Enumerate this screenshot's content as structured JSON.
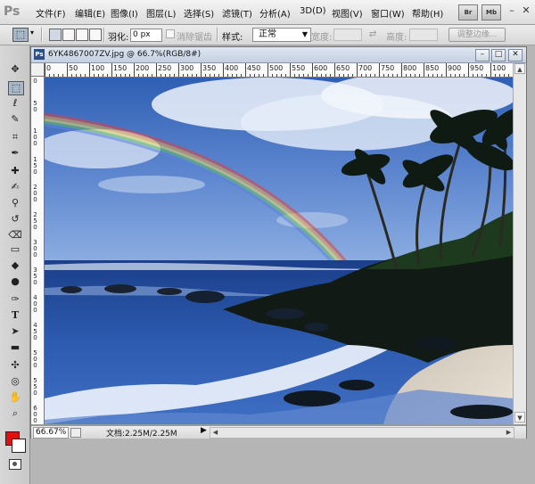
{
  "app": {
    "logo": "Ps"
  },
  "menu": {
    "items": [
      {
        "label": "文件(F)"
      },
      {
        "label": "编辑(E)"
      },
      {
        "label": "图像(I)"
      },
      {
        "label": "图层(L)"
      },
      {
        "label": "选择(S)"
      },
      {
        "label": "滤镜(T)"
      },
      {
        "label": "分析(A)"
      },
      {
        "label": "3D(D)"
      },
      {
        "label": "视图(V)"
      },
      {
        "label": "窗口(W)"
      },
      {
        "label": "帮助(H)"
      }
    ],
    "bridge_buttons": [
      {
        "label": "Br"
      },
      {
        "label": "Mb"
      }
    ],
    "window_controls": {
      "minimize": "–",
      "restore": "□",
      "close": "✕"
    }
  },
  "options": {
    "feather_label": "羽化:",
    "feather_value": "0 px",
    "antialias_label": "消除锯齿",
    "style_label": "样式:",
    "style_value": "正常",
    "width_label": "宽度:",
    "height_label": "高度:",
    "refine_edge_label": "调整边缘..."
  },
  "document": {
    "title": "6YK4867007ZV.jpg @ 66.7%(RGB/8#)",
    "zoom": "66.67%",
    "doc_info": "文档:2.25M/2.25M",
    "controls": {
      "minimize": "–",
      "restore": "□",
      "close": "✕"
    },
    "ruler_h": [
      "0",
      "50",
      "100",
      "150",
      "200",
      "250",
      "300",
      "350",
      "400",
      "450",
      "500",
      "550",
      "600",
      "650",
      "700",
      "750",
      "800",
      "850",
      "900",
      "950",
      "100"
    ],
    "ruler_v": [
      "0",
      "50",
      "100",
      "150",
      "200",
      "250",
      "300",
      "350",
      "400",
      "450",
      "500",
      "550",
      "600"
    ]
  },
  "tools": [
    {
      "name": "move-tool-icon",
      "glyph": "✥"
    },
    {
      "name": "marquee-tool-icon",
      "glyph": "⬚"
    },
    {
      "name": "lasso-tool-icon",
      "glyph": "ℓ"
    },
    {
      "name": "quick-selection-tool-icon",
      "glyph": "✎"
    },
    {
      "name": "crop-tool-icon",
      "glyph": "⌗"
    },
    {
      "name": "eyedropper-tool-icon",
      "glyph": "✒"
    },
    {
      "name": "healing-brush-tool-icon",
      "glyph": "✚"
    },
    {
      "name": "brush-tool-icon",
      "glyph": "✍"
    },
    {
      "name": "clone-stamp-tool-icon",
      "glyph": "⚲"
    },
    {
      "name": "history-brush-tool-icon",
      "glyph": "↺"
    },
    {
      "name": "eraser-tool-icon",
      "glyph": "⌫"
    },
    {
      "name": "gradient-tool-icon",
      "glyph": "▭"
    },
    {
      "name": "blur-tool-icon",
      "glyph": "💧"
    },
    {
      "name": "dodge-tool-icon",
      "glyph": "●"
    },
    {
      "name": "pen-tool-icon",
      "glyph": "✑"
    },
    {
      "name": "type-tool-icon",
      "glyph": "T"
    },
    {
      "name": "path-selection-tool-icon",
      "glyph": "➤"
    },
    {
      "name": "shape-tool-icon",
      "glyph": "▬"
    },
    {
      "name": "3d-rotate-tool-icon",
      "glyph": "✣"
    },
    {
      "name": "3d-orbit-tool-icon",
      "glyph": "◎"
    },
    {
      "name": "hand-tool-icon",
      "glyph": "✋"
    },
    {
      "name": "zoom-tool-icon",
      "glyph": "🔍"
    }
  ],
  "colors": {
    "foreground": "#e01010",
    "background": "#ffffff",
    "accent": "#2c4f8a"
  }
}
